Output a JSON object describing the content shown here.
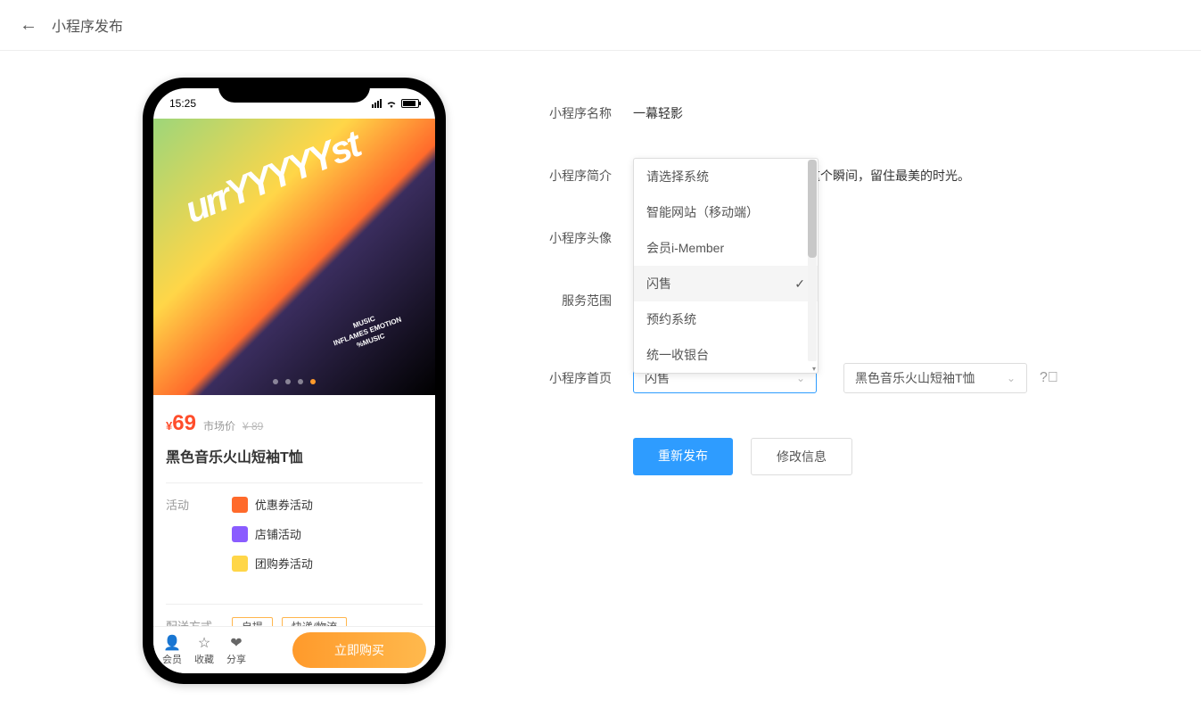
{
  "header": {
    "title": "小程序发布"
  },
  "phone": {
    "status_time": "15:25",
    "hero_brand": "urrYYYYYst",
    "hero_sub1": "MUSIC",
    "hero_sub2": "INFLAMES EMOTION",
    "hero_sub3": "%MUSIC",
    "price_symbol": "¥",
    "price": "69",
    "orig_label": "市场价",
    "orig_price": "¥ 89",
    "product_title": "黑色音乐火山短袖T恤",
    "activity_label": "活动",
    "activities": [
      {
        "name": "优惠券活动",
        "color": "#ff6a2b"
      },
      {
        "name": "店铺活动",
        "color": "#8a5cff"
      },
      {
        "name": "团购券活动",
        "color": "#ffd648"
      }
    ],
    "ship_label": "配送方式",
    "ship_opts": [
      "自提",
      "快递/物流"
    ],
    "bottom": {
      "member": "会员",
      "fav": "收藏",
      "share": "分享",
      "buy": "立即购买"
    }
  },
  "form": {
    "name_label": "小程序名称",
    "name_value": "一幕轻影",
    "desc_label": "小程序简介",
    "desc_value": "一幕轻影专注于婚纱摄影，捕捉这个瞬间，留住最美的时光。",
    "avatar_label": "小程序头像",
    "scope_label": "服务范围",
    "home_label": "小程序首页",
    "select1_value": "闪售",
    "select2_value": "黑色音乐火山短袖T恤",
    "dropdown": [
      "请选择系统",
      "智能网站（移动端）",
      "会员i-Member",
      "闪售",
      "预约系统",
      "统一收银台"
    ],
    "dropdown_selected": "闪售",
    "btn_publish": "重新发布",
    "btn_edit": "修改信息"
  }
}
